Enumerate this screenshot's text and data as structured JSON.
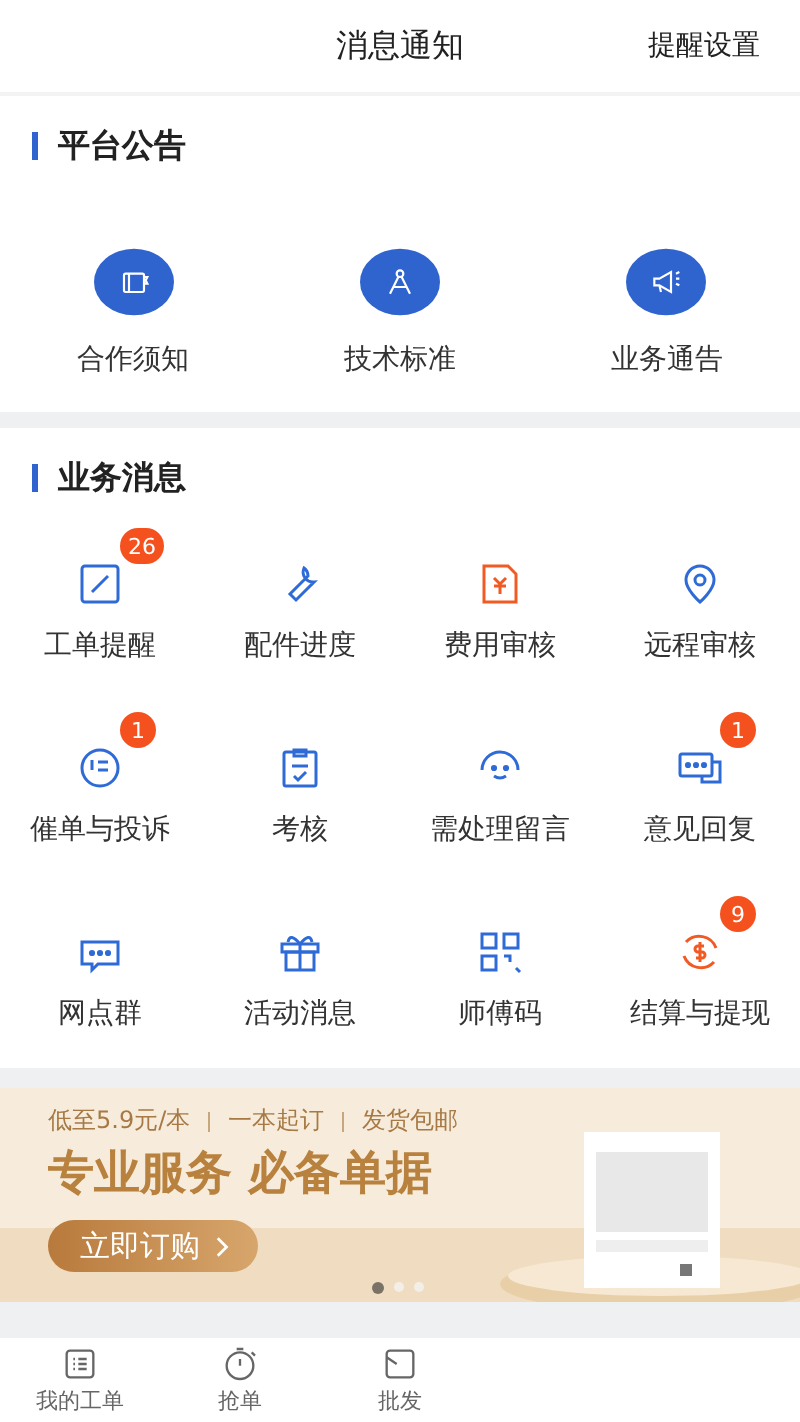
{
  "header": {
    "title": "消息通知",
    "action": "提醒设置"
  },
  "announcements": {
    "title": "平台公告",
    "items": [
      {
        "label": "合作须知"
      },
      {
        "label": "技术标准"
      },
      {
        "label": "业务通告"
      }
    ]
  },
  "messages": {
    "title": "业务消息",
    "items": [
      {
        "label": "工单提醒",
        "badge": "26"
      },
      {
        "label": "配件进度"
      },
      {
        "label": "费用审核"
      },
      {
        "label": "远程审核"
      },
      {
        "label": "催单与投诉",
        "badge": "1"
      },
      {
        "label": "考核"
      },
      {
        "label": "需处理留言"
      },
      {
        "label": "意见回复",
        "badge": "1"
      },
      {
        "label": "网点群"
      },
      {
        "label": "活动消息"
      },
      {
        "label": "师傅码"
      },
      {
        "label": "结算与提现",
        "badge": "9"
      }
    ]
  },
  "banner": {
    "tagline": [
      "低至5.9元/本",
      "一本起订",
      "发货包邮"
    ],
    "headline": "专业服务 必备单据",
    "button": "立即订购",
    "dots": [
      {
        "selected": true
      },
      {
        "selected": false
      },
      {
        "selected": false
      }
    ]
  },
  "tabbar": [
    {
      "label": "我的工单"
    },
    {
      "label": "抢单"
    },
    {
      "label": "批发"
    }
  ]
}
